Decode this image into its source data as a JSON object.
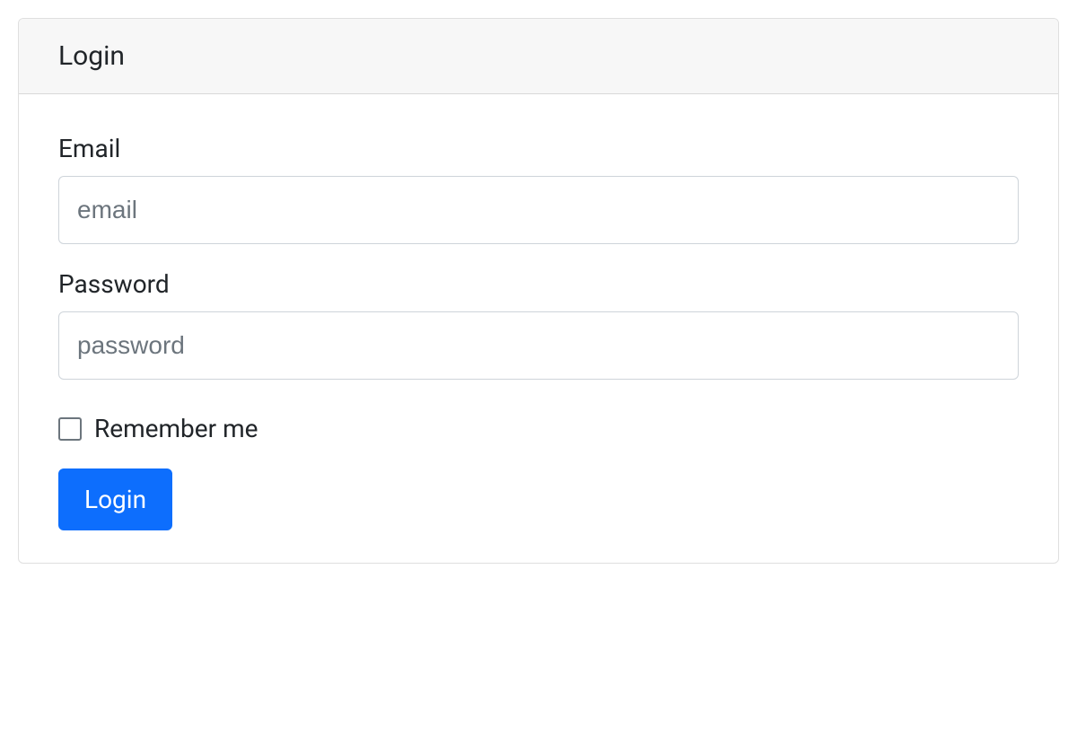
{
  "card": {
    "title": "Login"
  },
  "form": {
    "email": {
      "label": "Email",
      "placeholder": "email",
      "value": ""
    },
    "password": {
      "label": "Password",
      "placeholder": "password",
      "value": ""
    },
    "remember": {
      "label": "Remember me",
      "checked": false
    },
    "submit": {
      "label": "Login"
    }
  }
}
